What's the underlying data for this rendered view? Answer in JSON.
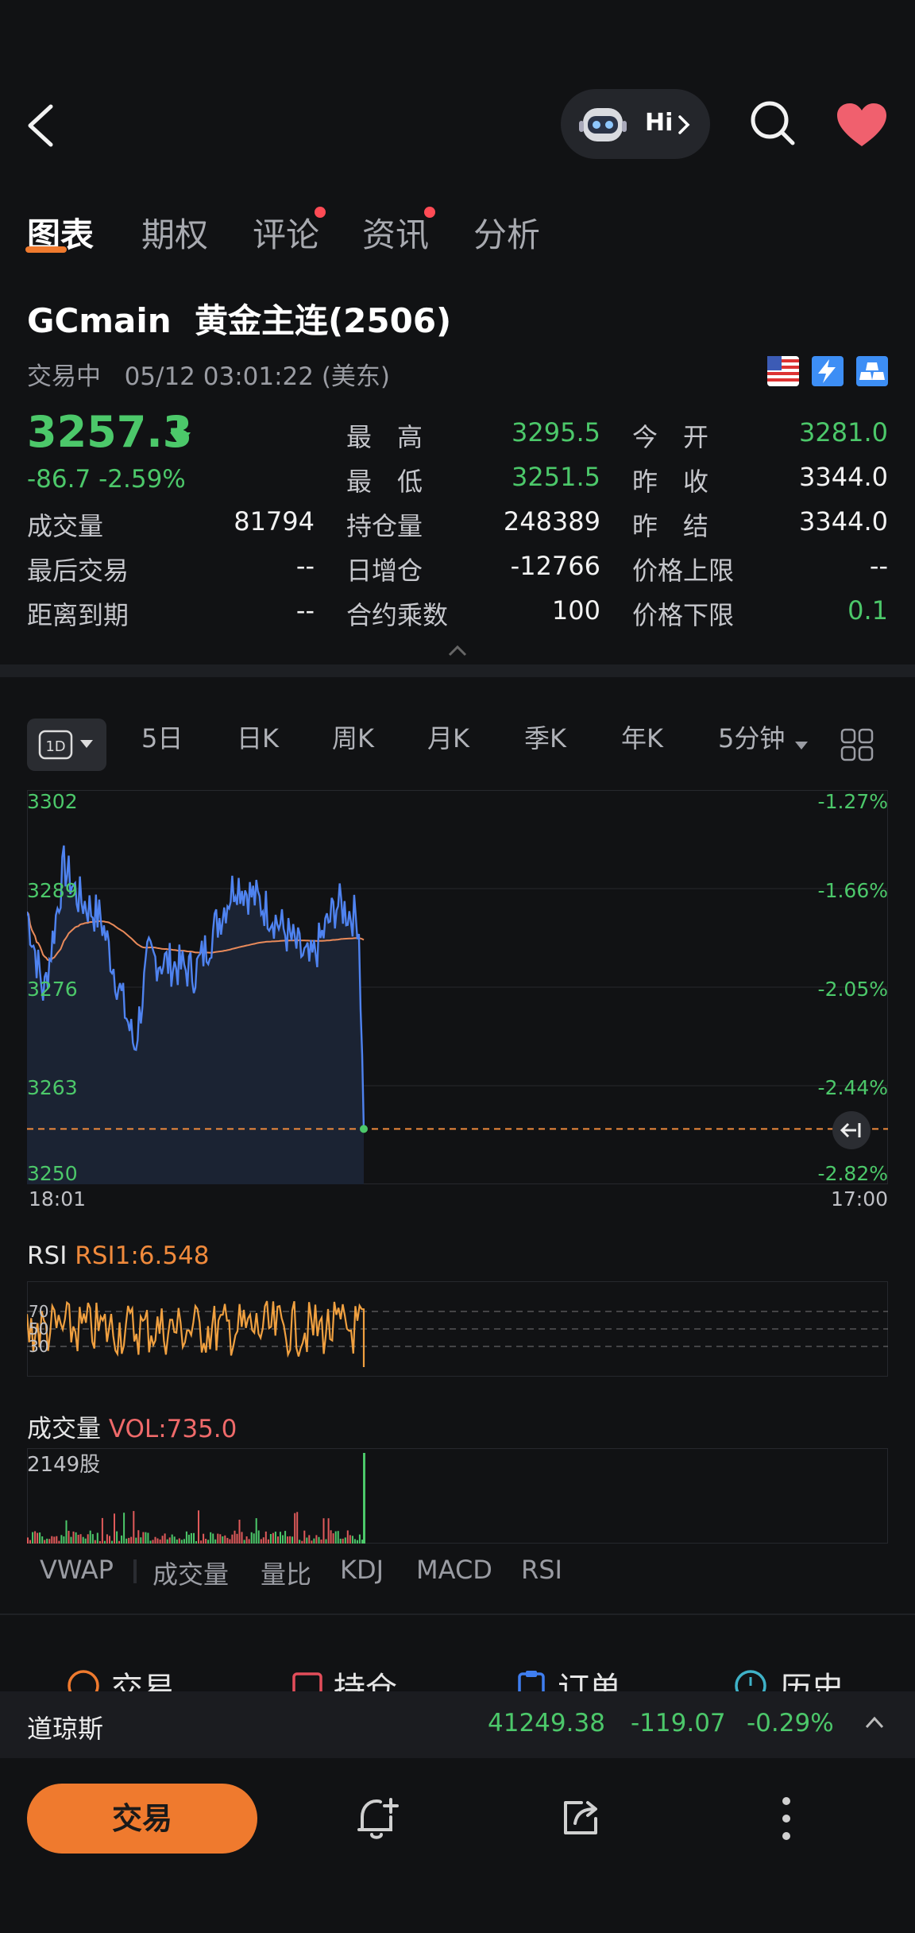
{
  "header": {
    "hi_label": "Hi"
  },
  "tabs": [
    {
      "label": "图表",
      "active": true,
      "dot": false
    },
    {
      "label": "期权",
      "active": false,
      "dot": false
    },
    {
      "label": "评论",
      "active": false,
      "dot": true
    },
    {
      "label": "资讯",
      "active": false,
      "dot": true
    },
    {
      "label": "分析",
      "active": false,
      "dot": false
    }
  ],
  "instrument": {
    "symbol": "GCmain",
    "name": "黄金主连(2506)",
    "status": "交易中",
    "datetime": "05/12 03:01:22 (美东)",
    "price": "3257.3",
    "change": "-86.7",
    "change_pct": "-2.59%"
  },
  "stats": {
    "col1": [
      {
        "label": "成交量",
        "value": "81794"
      },
      {
        "label": "最后交易",
        "value": "--"
      },
      {
        "label": "距离到期",
        "value": "--"
      }
    ],
    "col2": [
      {
        "label": "最　高",
        "value": "3295.5"
      },
      {
        "label": "最　低",
        "value": "3251.5"
      },
      {
        "label": "持仓量",
        "value": "248389"
      },
      {
        "label": "日增仓",
        "value": "-12766"
      },
      {
        "label": "合约乘数",
        "value": "100"
      }
    ],
    "col3": [
      {
        "label": "今　开",
        "value": "3281.0"
      },
      {
        "label": "昨　收",
        "value": "3344.0"
      },
      {
        "label": "昨　结",
        "value": "3344.0"
      },
      {
        "label": "价格上限",
        "value": "--"
      },
      {
        "label": "价格下限",
        "value": "0.1"
      }
    ]
  },
  "range_tabs": {
    "active": "1D",
    "items": [
      "5日",
      "日K",
      "周K",
      "月K",
      "季K",
      "年K",
      "5分钟"
    ]
  },
  "chart_data": {
    "type": "line",
    "y_ticks": [
      "3302",
      "3289",
      "3276",
      "3263",
      "3250"
    ],
    "pct_ticks": [
      "-1.27%",
      "-1.66%",
      "-2.05%",
      "-2.44%",
      "-2.82%"
    ],
    "x_labels": [
      "18:01",
      "17:00"
    ],
    "ylim": [
      3250,
      3302
    ],
    "current_price": 3257.3,
    "series": []
  },
  "rsi": {
    "label": "RSI",
    "value_label": "RSI1:6.548",
    "levels": [
      "70",
      "50",
      "30"
    ]
  },
  "volume": {
    "label": "成交量",
    "value_label": "VOL:735.0",
    "max_label": "2149股"
  },
  "indicators": [
    "VWAP",
    "成交量",
    "量比",
    "KDJ",
    "MACD",
    "RSI"
  ],
  "active_indicators": [
    "VWAP",
    "成交量",
    "RSI"
  ],
  "actions_peek": [
    "交易",
    "持仓",
    "订单",
    "历史"
  ],
  "index_bar": {
    "name": "道琼斯",
    "value": "41249.38",
    "change": "-119.07",
    "pct": "-0.29%"
  },
  "bottom": {
    "trade_label": "交易"
  },
  "colors": {
    "accent": "#ef7a2e",
    "down": "#4cc86a",
    "price_line": "#4f83f0",
    "avg_line": "#e98a5a",
    "rsi": "#f0a040"
  }
}
